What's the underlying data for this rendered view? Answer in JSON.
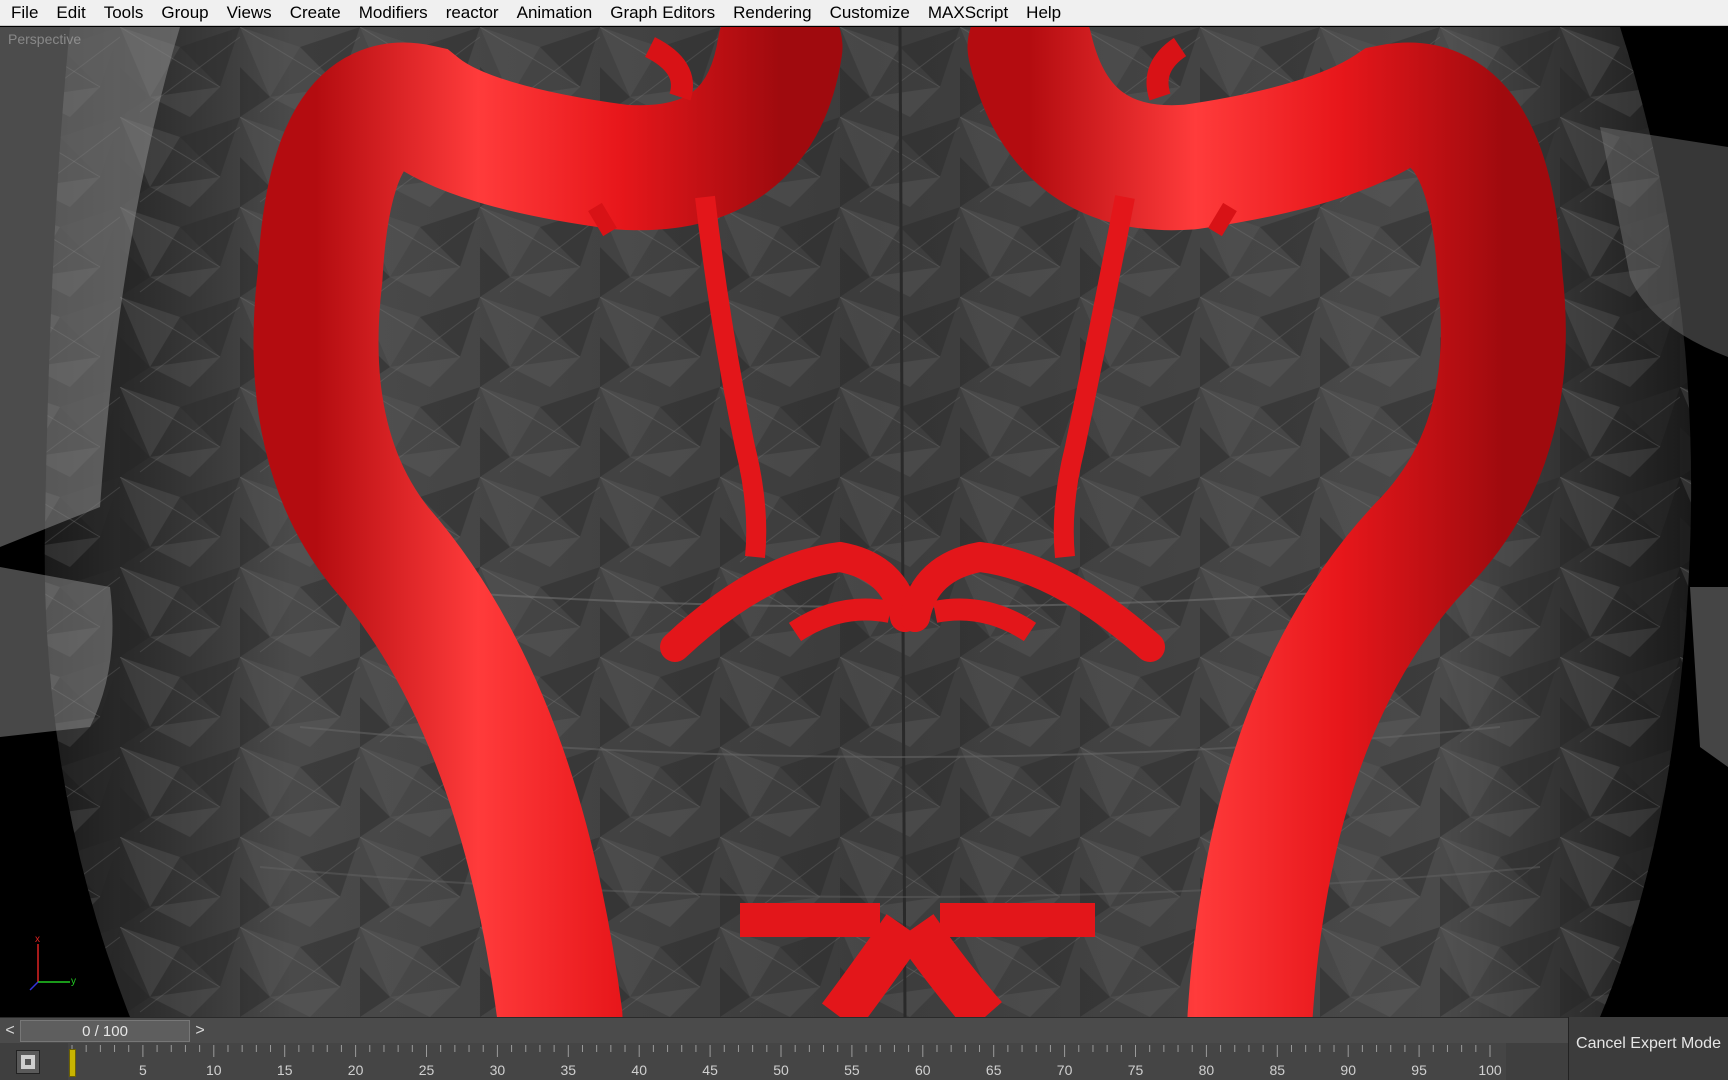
{
  "menu": {
    "items": [
      {
        "label": "File"
      },
      {
        "label": "Edit"
      },
      {
        "label": "Tools"
      },
      {
        "label": "Group"
      },
      {
        "label": "Views"
      },
      {
        "label": "Create"
      },
      {
        "label": "Modifiers"
      },
      {
        "label": "reactor"
      },
      {
        "label": "Animation"
      },
      {
        "label": "Graph Editors"
      },
      {
        "label": "Rendering"
      },
      {
        "label": "Customize"
      },
      {
        "label": "MAXScript"
      },
      {
        "label": "Help"
      }
    ]
  },
  "viewport": {
    "label": "Perspective",
    "axes": {
      "x": "x",
      "y": "y",
      "z": "z"
    },
    "colors": {
      "vessel": "#e01418",
      "vessel_highlight": "#ff4a4a",
      "brain_mesh": "#3a3a3a",
      "background": "#000000"
    }
  },
  "time_slider": {
    "prev_label": "<",
    "next_label": ">",
    "thumb_text": "0 / 100",
    "current_frame": 0,
    "total_frames": 100
  },
  "trackbar": {
    "tick_labels": [
      "5",
      "10",
      "15",
      "20",
      "25",
      "30",
      "35",
      "40",
      "45",
      "50",
      "55",
      "60",
      "65",
      "70",
      "75",
      "80",
      "85",
      "90",
      "95",
      "100"
    ]
  },
  "status": {
    "cancel_expert_mode": "Cancel Expert Mode"
  }
}
